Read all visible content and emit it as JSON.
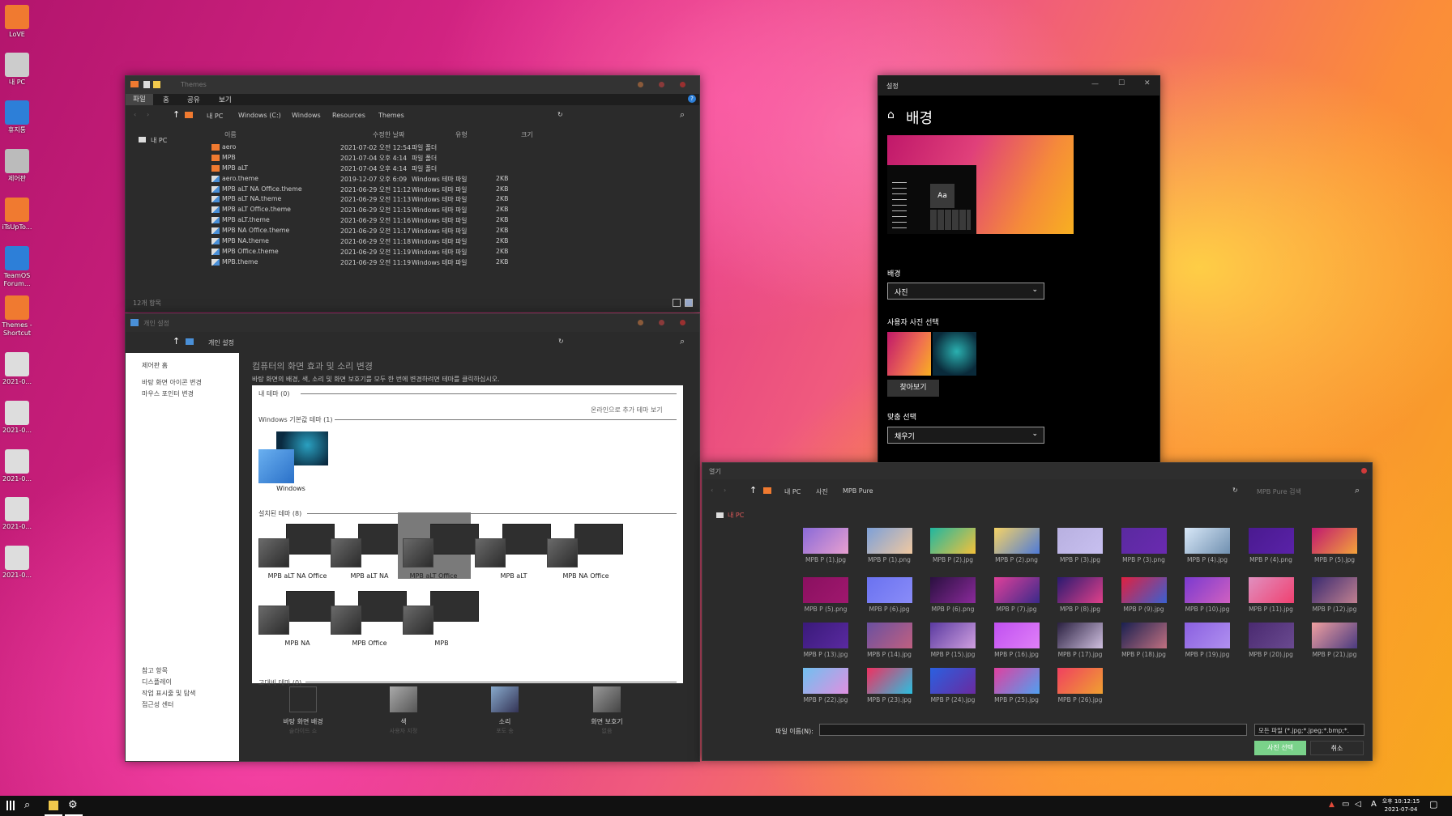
{
  "desktop": {
    "icons": [
      {
        "label": "LoVE",
        "color": "#f07a30"
      },
      {
        "label": "내 PC",
        "color": "#cccccc"
      },
      {
        "label": "휴지통",
        "color": "#2d7fd8"
      },
      {
        "label": "제어판",
        "color": "#bbbbbb"
      },
      {
        "label": "iTsUpTo...",
        "color": "#f07a30"
      },
      {
        "label": "TeamOS Forum...",
        "color": "#2d7fd8"
      },
      {
        "label": "Themes - Shortcut",
        "color": "#f07a30"
      },
      {
        "label": "2021-0...",
        "color": "#dddddd"
      },
      {
        "label": "2021-0...",
        "color": "#dddddd"
      },
      {
        "label": "2021-0...",
        "color": "#dddddd"
      },
      {
        "label": "2021-0...",
        "color": "#dddddd"
      },
      {
        "label": "2021-0...",
        "color": "#dddddd"
      }
    ]
  },
  "explorer": {
    "title": "Themes",
    "ribbon": [
      "파일",
      "홈",
      "공유",
      "보기"
    ],
    "path": [
      "내 PC",
      "Windows (C:)",
      "Windows",
      "Resources",
      "Themes"
    ],
    "nav": "내 PC",
    "columns": [
      "이름",
      "수정한 날짜",
      "유형",
      "크기"
    ],
    "files": [
      {
        "name": "aero",
        "date": "2021-07-02 오전 12:54",
        "type": "파일 폴더",
        "size": "",
        "folder": true
      },
      {
        "name": "MPB",
        "date": "2021-07-04 오후 4:14",
        "type": "파일 폴더",
        "size": "",
        "folder": true
      },
      {
        "name": "MPB aLT",
        "date": "2021-07-04 오후 4:14",
        "type": "파일 폴더",
        "size": "",
        "folder": true
      },
      {
        "name": "aero.theme",
        "date": "2019-12-07 오후 6:09",
        "type": "Windows 테마 파일",
        "size": "2KB",
        "folder": false
      },
      {
        "name": "MPB aLT NA Office.theme",
        "date": "2021-06-29 오전 11:12",
        "type": "Windows 테마 파일",
        "size": "2KB",
        "folder": false
      },
      {
        "name": "MPB aLT NA.theme",
        "date": "2021-06-29 오전 11:13",
        "type": "Windows 테마 파일",
        "size": "2KB",
        "folder": false
      },
      {
        "name": "MPB aLT Office.theme",
        "date": "2021-06-29 오전 11:15",
        "type": "Windows 테마 파일",
        "size": "2KB",
        "folder": false
      },
      {
        "name": "MPB aLT.theme",
        "date": "2021-06-29 오전 11:16",
        "type": "Windows 테마 파일",
        "size": "2KB",
        "folder": false
      },
      {
        "name": "MPB NA Office.theme",
        "date": "2021-06-29 오전 11:17",
        "type": "Windows 테마 파일",
        "size": "2KB",
        "folder": false
      },
      {
        "name": "MPB NA.theme",
        "date": "2021-06-29 오전 11:18",
        "type": "Windows 테마 파일",
        "size": "2KB",
        "folder": false
      },
      {
        "name": "MPB Office.theme",
        "date": "2021-06-29 오전 11:19",
        "type": "Windows 테마 파일",
        "size": "2KB",
        "folder": false
      },
      {
        "name": "MPB.theme",
        "date": "2021-06-29 오전 11:19",
        "type": "Windows 테마 파일",
        "size": "2KB",
        "folder": false
      }
    ],
    "status": "12개 항목"
  },
  "personalize": {
    "title": "개인 설정",
    "path": "개인 설정",
    "side_top": "제어판 홈",
    "side_links": [
      "바탕 화면 아이콘 변경",
      "마우스 포인터 변경"
    ],
    "see_also": "참고 항목",
    "side_bottom": [
      "디스플레이",
      "작업 표시줄 및 탐색",
      "접근성 센터"
    ],
    "heading": "컴퓨터의 화면 효과 및 소리 변경",
    "desc": "바탕 화면의 배경, 색, 소리 및 화면 보호기를 모두 한 번에 변경하려면 테마를 클릭하십시오.",
    "sec_my": "내 테마 (0)",
    "online": "온라인으로 추가 테마 보기",
    "sec_default": "Windows 기본값 테마 (1)",
    "default_theme": "Windows",
    "sec_installed": "설치된 테마 (8)",
    "installed": [
      "MPB aLT NA Office",
      "MPB aLT NA",
      "MPB aLT Office",
      "MPB aLT",
      "MPB NA Office",
      "MPB NA",
      "MPB Office",
      "MPB"
    ],
    "sec_hc": "고대비 테마 (0)",
    "bottom": [
      {
        "label": "바탕 화면 배경",
        "sub": "슬라이드 쇼"
      },
      {
        "label": "색",
        "sub": "사용자 지정"
      },
      {
        "label": "소리",
        "sub": "포도 송"
      },
      {
        "label": "화면 보호기",
        "sub": "없음"
      }
    ]
  },
  "settings": {
    "title": "설정",
    "heading": "배경",
    "preview_text": "Aa",
    "bg_label": "배경",
    "bg_value": "사진",
    "choose_label": "사용자 사진 선택",
    "browse": "찾아보기",
    "fit_label": "맞춤 선택",
    "fit_value": "채우기"
  },
  "open_dialog": {
    "title": "열기",
    "path": [
      "내 PC",
      "사진",
      "MPB Pure"
    ],
    "search_placeholder": "MPB Pure 검색",
    "nav": "내 PC",
    "files": [
      {
        "name": "MPB P (1).jpg",
        "c1": "#8a6ad8",
        "c2": "#e8a0d0"
      },
      {
        "name": "MPB P (1).png",
        "c1": "#7da0d8",
        "c2": "#f0c8a0"
      },
      {
        "name": "MPB P (2).jpg",
        "c1": "#1fb7a0",
        "c2": "#f4c13a"
      },
      {
        "name": "MPB P (2).png",
        "c1": "#f6d365",
        "c2": "#4f7bd8"
      },
      {
        "name": "MPB P (3).jpg",
        "c1": "#b8b0e0",
        "c2": "#c8c0f0"
      },
      {
        "name": "MPB P (3).png",
        "c1": "#5a2aa0",
        "c2": "#6a2ab0"
      },
      {
        "name": "MPB P (4).jpg",
        "c1": "#d8e8f8",
        "c2": "#7090b0"
      },
      {
        "name": "MPB P (4).png",
        "c1": "#4a1a90",
        "c2": "#5a22a8"
      },
      {
        "name": "MPB P (5).jpg",
        "c1": "#c01870",
        "c2": "#f3a33a"
      },
      {
        "name": "MPB P (5).png",
        "c1": "#8a1060",
        "c2": "#a0186e"
      },
      {
        "name": "MPB P (6).jpg",
        "c1": "#6a72f0",
        "c2": "#8a8cf8"
      },
      {
        "name": "MPB P (6).png",
        "c1": "#2a1040",
        "c2": "#8a2a9a"
      },
      {
        "name": "MPB P (7).jpg",
        "c1": "#e0409a",
        "c2": "#3a2a8a"
      },
      {
        "name": "MPB P (8).jpg",
        "c1": "#2a1a70",
        "c2": "#e0408a"
      },
      {
        "name": "MPB P (9).jpg",
        "c1": "#e02040",
        "c2": "#3a60d0"
      },
      {
        "name": "MPB P (10).jpg",
        "c1": "#7a3ad0",
        "c2": "#d060c0"
      },
      {
        "name": "MPB P (11).jpg",
        "c1": "#e090c0",
        "c2": "#f04070"
      },
      {
        "name": "MPB P (12).jpg",
        "c1": "#3a2a70",
        "c2": "#c08090"
      },
      {
        "name": "MPB P (13).jpg",
        "c1": "#3a1a7a",
        "c2": "#5a2aa0"
      },
      {
        "name": "MPB P (14).jpg",
        "c1": "#6a50a0",
        "c2": "#c06080"
      },
      {
        "name": "MPB P (15).jpg",
        "c1": "#5a3aa0",
        "c2": "#d0a0e0"
      },
      {
        "name": "MPB P (16).jpg",
        "c1": "#c050f0",
        "c2": "#e080f8"
      },
      {
        "name": "MPB P (17).jpg",
        "c1": "#2a2040",
        "c2": "#d0c0e0"
      },
      {
        "name": "MPB P (18).jpg",
        "c1": "#1a2050",
        "c2": "#c07080"
      },
      {
        "name": "MPB P (19).jpg",
        "c1": "#8a60e0",
        "c2": "#b090f0"
      },
      {
        "name": "MPB P (20).jpg",
        "c1": "#4a2a70",
        "c2": "#6a4a90"
      },
      {
        "name": "MPB P (21).jpg",
        "c1": "#f0a0a0",
        "c2": "#4a3a80"
      },
      {
        "name": "MPB P (22).jpg",
        "c1": "#70c0f0",
        "c2": "#e090e0"
      },
      {
        "name": "MPB P (23).jpg",
        "c1": "#f03060",
        "c2": "#2ac0e0"
      },
      {
        "name": "MPB P (24).jpg",
        "c1": "#2a60e0",
        "c2": "#6a2aa0"
      },
      {
        "name": "MPB P (25).jpg",
        "c1": "#e040a0",
        "c2": "#50a0f0"
      },
      {
        "name": "MPB P (26).jpg",
        "c1": "#f04060",
        "c2": "#f0a030"
      }
    ],
    "filename_label": "파일 이름(N):",
    "filetype": "모든 파일 (*.jpg;*.jpeg;*.bmp;*.",
    "ok": "사진 선택",
    "cancel": "취소"
  },
  "taskbar": {
    "time": "오후 10:12:15",
    "date": "2021-07-04",
    "ime": "A"
  }
}
